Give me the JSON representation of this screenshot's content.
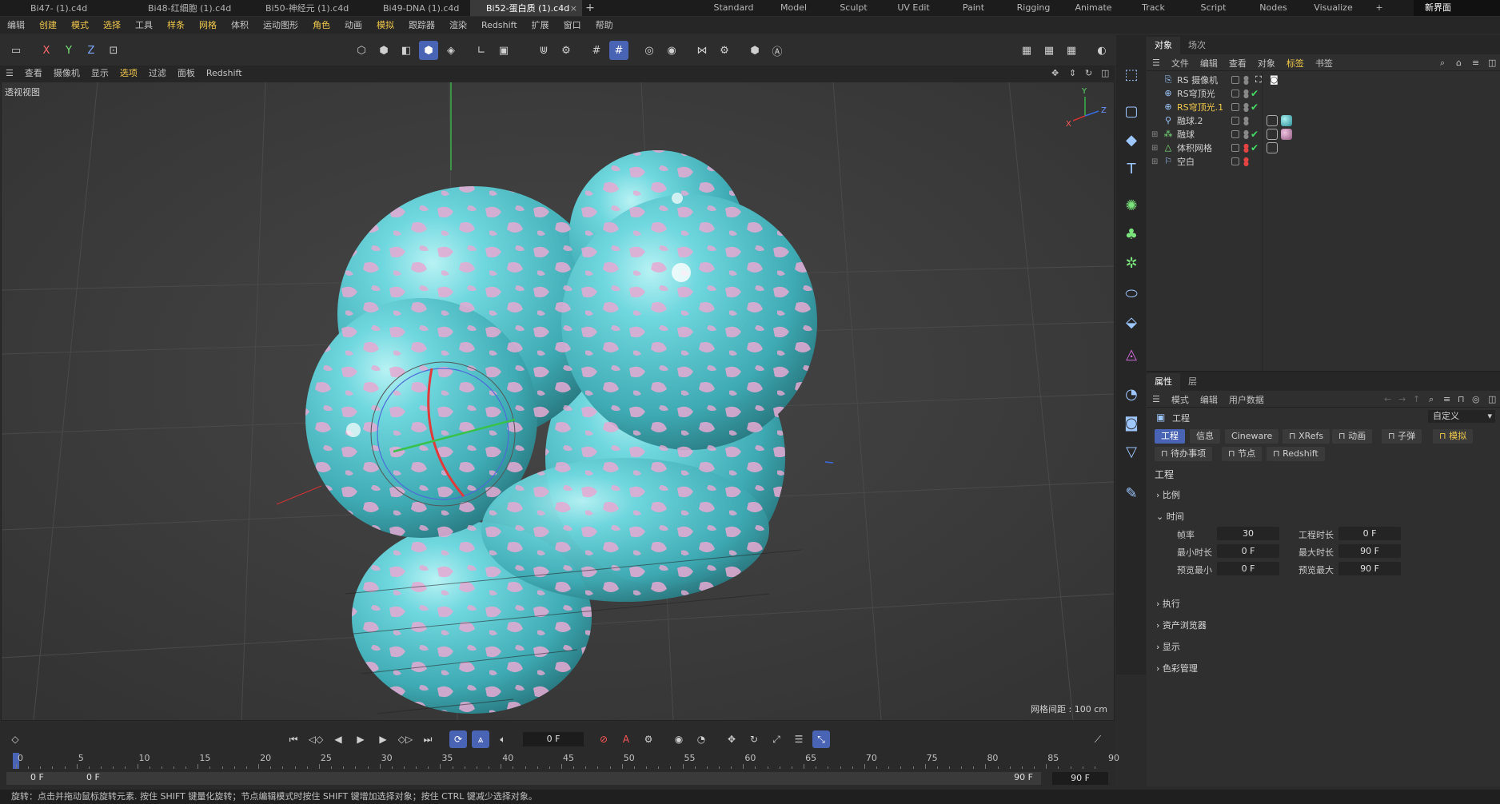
{
  "tabs": [
    {
      "label": "Bi47- (1).c4d",
      "active": false
    },
    {
      "label": "Bi48-红细胞 (1).c4d",
      "active": false
    },
    {
      "label": "Bi50-神经元 (1).c4d",
      "active": false
    },
    {
      "label": "Bi49-DNA (1).c4d",
      "active": false
    },
    {
      "label": "Bi52-蛋白质 (1).c4d",
      "active": true
    }
  ],
  "tab_close": "×",
  "tab_add": "+",
  "layouts": [
    "Standard",
    "Model",
    "Sculpt",
    "UV Edit",
    "Paint",
    "Rigging",
    "Animate",
    "Track",
    "Script",
    "Nodes",
    "Visualize"
  ],
  "layout_add": "+",
  "new_ui": "新界面",
  "menu": [
    {
      "label": "编辑",
      "hl": false
    },
    {
      "label": "创建",
      "hl": true
    },
    {
      "label": "模式",
      "hl": true
    },
    {
      "label": "选择",
      "hl": true
    },
    {
      "label": "工具",
      "hl": false
    },
    {
      "label": "样条",
      "hl": true
    },
    {
      "label": "网格",
      "hl": true
    },
    {
      "label": "体积",
      "hl": false
    },
    {
      "label": "运动图形",
      "hl": false
    },
    {
      "label": "角色",
      "hl": true
    },
    {
      "label": "动画",
      "hl": false
    },
    {
      "label": "模拟",
      "hl": true
    },
    {
      "label": "跟踪器",
      "hl": false
    },
    {
      "label": "渲染",
      "hl": false
    },
    {
      "label": "Redshift",
      "hl": false
    },
    {
      "label": "扩展",
      "hl": false
    },
    {
      "label": "窗口",
      "hl": false
    },
    {
      "label": "帮助",
      "hl": false
    }
  ],
  "axes": {
    "x": "X",
    "y": "Y",
    "z": "Z"
  },
  "view_menu": [
    {
      "label": "查看",
      "hl": false
    },
    {
      "label": "摄像机",
      "hl": false
    },
    {
      "label": "显示",
      "hl": false
    },
    {
      "label": "选项",
      "hl": true
    },
    {
      "label": "过滤",
      "hl": false
    },
    {
      "label": "面板",
      "hl": false
    },
    {
      "label": "Redshift",
      "hl": false
    }
  ],
  "viewport": {
    "title": "透视视图",
    "grid_readout": "网格间距 : 100 cm",
    "gizmo": {
      "x": "X",
      "y": "Y",
      "z": "Z"
    }
  },
  "object_panel": {
    "tabs": [
      "对象",
      "场次"
    ],
    "menu": [
      {
        "label": "文件",
        "hl": false
      },
      {
        "label": "编辑",
        "hl": false
      },
      {
        "label": "查看",
        "hl": false
      },
      {
        "label": "对象",
        "hl": false
      },
      {
        "label": "标签",
        "hl": true
      },
      {
        "label": "书签",
        "hl": false
      }
    ],
    "objects": [
      {
        "name": "RS 摄像机",
        "hl": false,
        "check": false,
        "expand": ""
      },
      {
        "name": "RS穹顶光",
        "hl": false,
        "check": true,
        "expand": ""
      },
      {
        "name": "RS穹顶光.1",
        "hl": true,
        "check": true,
        "expand": ""
      },
      {
        "name": "融球.2",
        "hl": false,
        "check": false,
        "expand": ""
      },
      {
        "name": "融球",
        "hl": false,
        "check": true,
        "expand": "⊞"
      },
      {
        "name": "体积网格",
        "hl": false,
        "check": true,
        "expand": "⊞"
      },
      {
        "name": "空白",
        "hl": false,
        "check": false,
        "expand": "⊞"
      }
    ]
  },
  "attr_panel": {
    "tabs": [
      "属性",
      "层"
    ],
    "menu": [
      "模式",
      "编辑",
      "用户数据"
    ],
    "context": "工程",
    "preset": "自定义",
    "tab_row1": [
      {
        "label": "工程",
        "on": true,
        "hl": false
      },
      {
        "label": "信息",
        "on": false,
        "hl": false
      },
      {
        "label": "Cineware",
        "on": false,
        "hl": false
      },
      {
        "label": "XRefs",
        "on": false,
        "hl": false
      },
      {
        "label": "动画",
        "on": false,
        "hl": false
      },
      {
        "label": "子弹",
        "on": false,
        "hl": false
      },
      {
        "label": "模拟",
        "on": false,
        "hl": true
      }
    ],
    "tab_row2": [
      {
        "label": "待办事项",
        "on": false,
        "hl": false
      },
      {
        "label": "节点",
        "on": false,
        "hl": false
      },
      {
        "label": "Redshift",
        "on": false,
        "hl": false
      }
    ],
    "section_title": "工程",
    "sections": [
      "比例",
      "时间",
      "执行",
      "资产浏览器",
      "显示",
      "色彩管理"
    ],
    "time_props": [
      {
        "label": "帧率",
        "value": "30"
      },
      {
        "label": "工程时长",
        "value": "0 F"
      },
      {
        "label": "最小时长",
        "value": "0 F"
      },
      {
        "label": "最大时长",
        "value": "90 F"
      },
      {
        "label": "预览最小",
        "value": "0 F"
      },
      {
        "label": "预览最大",
        "value": "90 F"
      }
    ]
  },
  "timeline": {
    "current_frame": "0 F",
    "ruler": [
      "0",
      "5",
      "10",
      "15",
      "20",
      "25",
      "30",
      "35",
      "40",
      "45",
      "50",
      "55",
      "60",
      "65",
      "70",
      "75",
      "80",
      "85",
      "90"
    ],
    "range_start": "0 F",
    "range_mid": "0 F",
    "range_end": "90 F",
    "range_end_field": "90 F",
    "auto_key": "A"
  },
  "status": "旋转：点击并拖动鼠标旋转元素. 按住 SHIFT 键量化旋转；节点编辑模式时按住 SHIFT 键增加选择对象；按住 CTRL 键减少选择对象。",
  "colors": {
    "accent": "#4a64b5",
    "highlight": "#f2c94c",
    "blob_cyan": "#5fd0d8",
    "blob_pink": "#e4a6cf"
  }
}
